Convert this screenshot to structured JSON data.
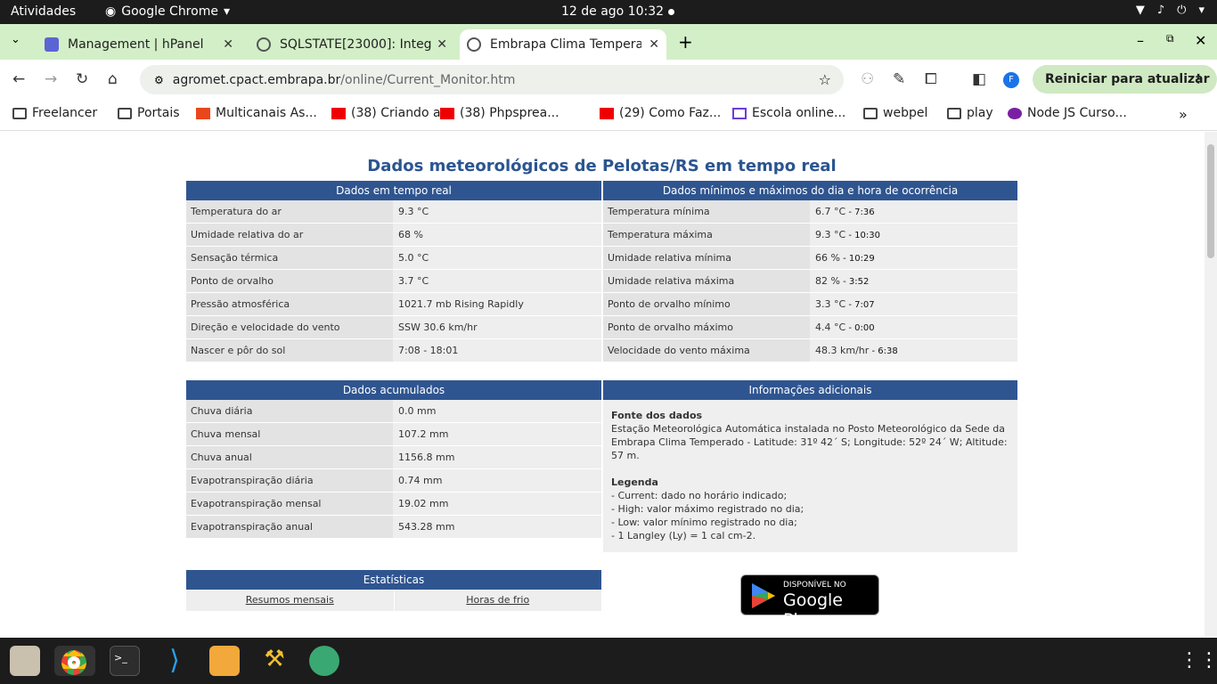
{
  "topbar": {
    "activities": "Atividades",
    "app": "Google Chrome",
    "clock": "12 de ago  10:32"
  },
  "tabs": [
    {
      "title": "Management | hPanel",
      "close": "✕"
    },
    {
      "title": "SQLSTATE[23000]: Integ",
      "close": "✕"
    },
    {
      "title": "Embrapa Clima Temperado",
      "close": "✕"
    }
  ],
  "toolbar": {
    "url_host": "agromet.cpact.embrapa.br",
    "url_path": "/online/Current_Monitor.htm",
    "profile": "F",
    "restart": "Reiniciar para atualizar"
  },
  "bookmarks": [
    "Freelancer",
    "Portais",
    "Multicanais As...",
    "(38) Criando a...",
    "(38) Phpsprea...",
    "(29) Como Faz...",
    "Escola online...",
    "webpel",
    "play",
    "Node JS Curso..."
  ],
  "page": {
    "title": "Dados meteorológicos de Pelotas/RS em tempo real",
    "realtime": {
      "header": "Dados em tempo real",
      "rows": [
        {
          "label": "Temperatura do ar",
          "value": "9.3 °C"
        },
        {
          "label": "Umidade relativa do ar",
          "value": "68 %"
        },
        {
          "label": "Sensação térmica",
          "value": "5.0 °C"
        },
        {
          "label": "Ponto de orvalho",
          "value": "3.7 °C"
        },
        {
          "label": "Pressão atmosférica",
          "value": "1021.7 mb Rising Rapidly"
        },
        {
          "label": "Direção e velocidade do vento",
          "value": "SSW    30.6 km/hr"
        },
        {
          "label": "Nascer e pôr do sol",
          "value": "7:08 - 18:01"
        }
      ]
    },
    "minmax": {
      "header": "Dados mínimos e máximos do dia e hora de ocorrência",
      "rows": [
        {
          "label": "Temperatura mínima",
          "value": "6.7 °C",
          "time": " - 7:36"
        },
        {
          "label": "Temperatura máxima",
          "value": "9.3 °C",
          "time": " - 10:30"
        },
        {
          "label": "Umidade relativa mínima",
          "value": "66 %",
          "time": " - 10:29"
        },
        {
          "label": "Umidade relativa máxima",
          "value": "82 %",
          "time": " - 3:52"
        },
        {
          "label": "Ponto de orvalho mínimo",
          "value": "3.3 °C",
          "time": " - 7:07"
        },
        {
          "label": "Ponto de orvalho máximo",
          "value": "4.4 °C",
          "time": " - 0:00"
        },
        {
          "label": "Velocidade do vento máxima",
          "value": "48.3 km/hr",
          "time": " - 6:38"
        }
      ]
    },
    "accum": {
      "header": "Dados acumulados",
      "rows": [
        {
          "label": "Chuva diária",
          "value": "0.0 mm"
        },
        {
          "label": "Chuva mensal",
          "value": "107.2 mm"
        },
        {
          "label": "Chuva anual",
          "value": "1156.8 mm"
        },
        {
          "label": "Evapotranspiração diária",
          "value": "0.74 mm"
        },
        {
          "label": "Evapotranspiração mensal",
          "value": "19.02 mm"
        },
        {
          "label": "Evapotranspiração anual",
          "value": "543.28 mm"
        }
      ]
    },
    "info": {
      "header": "Informações adicionais",
      "source_title": "Fonte dos dados",
      "source_text": "Estação Meteorológica Automática instalada no Posto Meteorológico da Sede da Embrapa Clima Temperado - Latitude: 31º 42´ S; Longitude: 52º 24´ W; Altitude: 57 m.",
      "legend_title": "Legenda",
      "legend": [
        "- Current: dado no horário indicado;",
        "- High: valor máximo registrado no dia;",
        "- Low: valor mínimo registrado no dia;",
        "- 1 Langley (Ly) = 1 cal cm-2."
      ]
    },
    "stats": {
      "header": "Estatísticas",
      "links": [
        "Resumos mensais",
        "Horas de frio"
      ]
    },
    "gplay": {
      "small": "DISPONÍVEL NO",
      "big": "Google Play"
    }
  }
}
